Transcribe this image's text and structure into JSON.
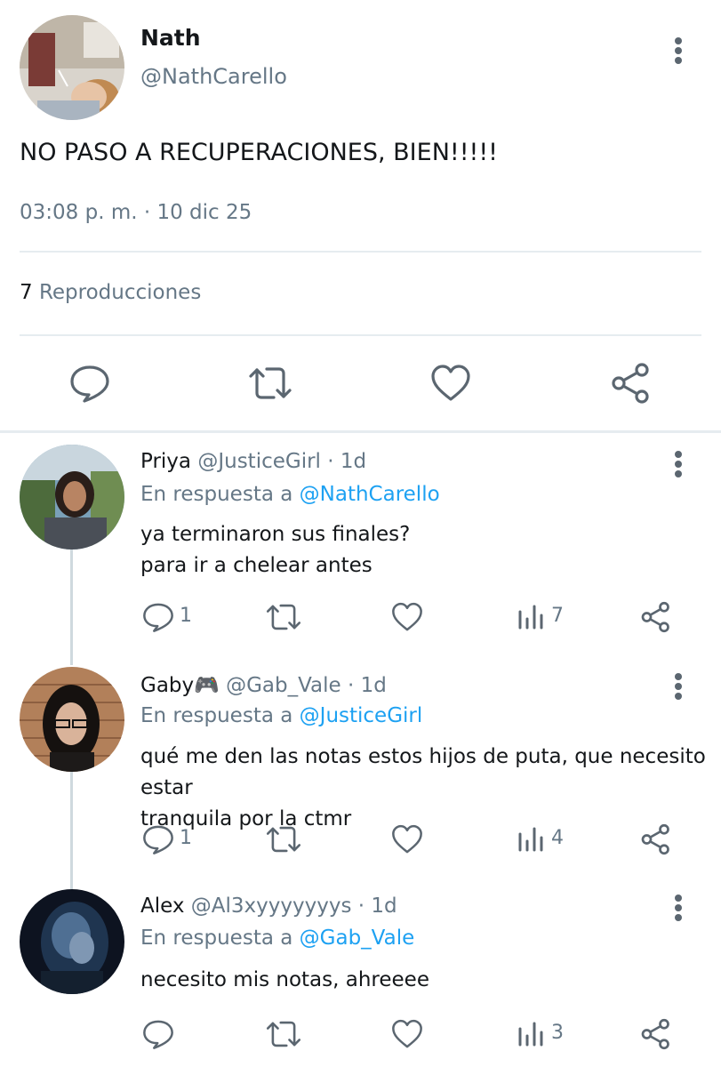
{
  "main_tweet": {
    "name": "Nath",
    "handle": "@NathCarello",
    "text": "NO PASO A RECUPERACIONES, BIEN!!!!!",
    "meta": "03:08 p. m. · 10 dic 25",
    "views_count": "7",
    "views_label": "Reproducciones"
  },
  "replies": [
    {
      "name": "Priya",
      "handle": "@JusticeGirl",
      "sep": "·",
      "time": "1d",
      "reply_prefix": "En respuesta a",
      "reply_to": "@NathCarello",
      "text_lines": [
        "ya terminaron sus finales?",
        "para ir a chelear antes"
      ],
      "reply_count": "1",
      "views": "7"
    },
    {
      "name": "Gaby🎮",
      "handle": "@Gab_Vale",
      "sep": "·",
      "time": "1d",
      "reply_prefix": "En respuesta a",
      "reply_to": "@JusticeGirl",
      "text_lines": [
        "qué me den las notas estos hijos de puta, que necesito estar",
        "tranquila por la ctmr"
      ],
      "reply_count": "1",
      "views": "4"
    },
    {
      "name": "Alex",
      "handle": "@Al3xyyyyyyys",
      "sep": "·",
      "time": "1d",
      "reply_prefix": "En respuesta a",
      "reply_to": "@Gab_Vale",
      "text_lines": [
        "necesito mis notas, ahreeee"
      ],
      "reply_count": "",
      "views": "3"
    }
  ],
  "colors": {
    "secondary_text": "#657786",
    "mention": "#1da1f2",
    "divider": "#e6ecf0"
  },
  "icons": [
    "more-icon",
    "reply-icon",
    "retweet-icon",
    "like-icon",
    "share-icon",
    "views-icon"
  ]
}
